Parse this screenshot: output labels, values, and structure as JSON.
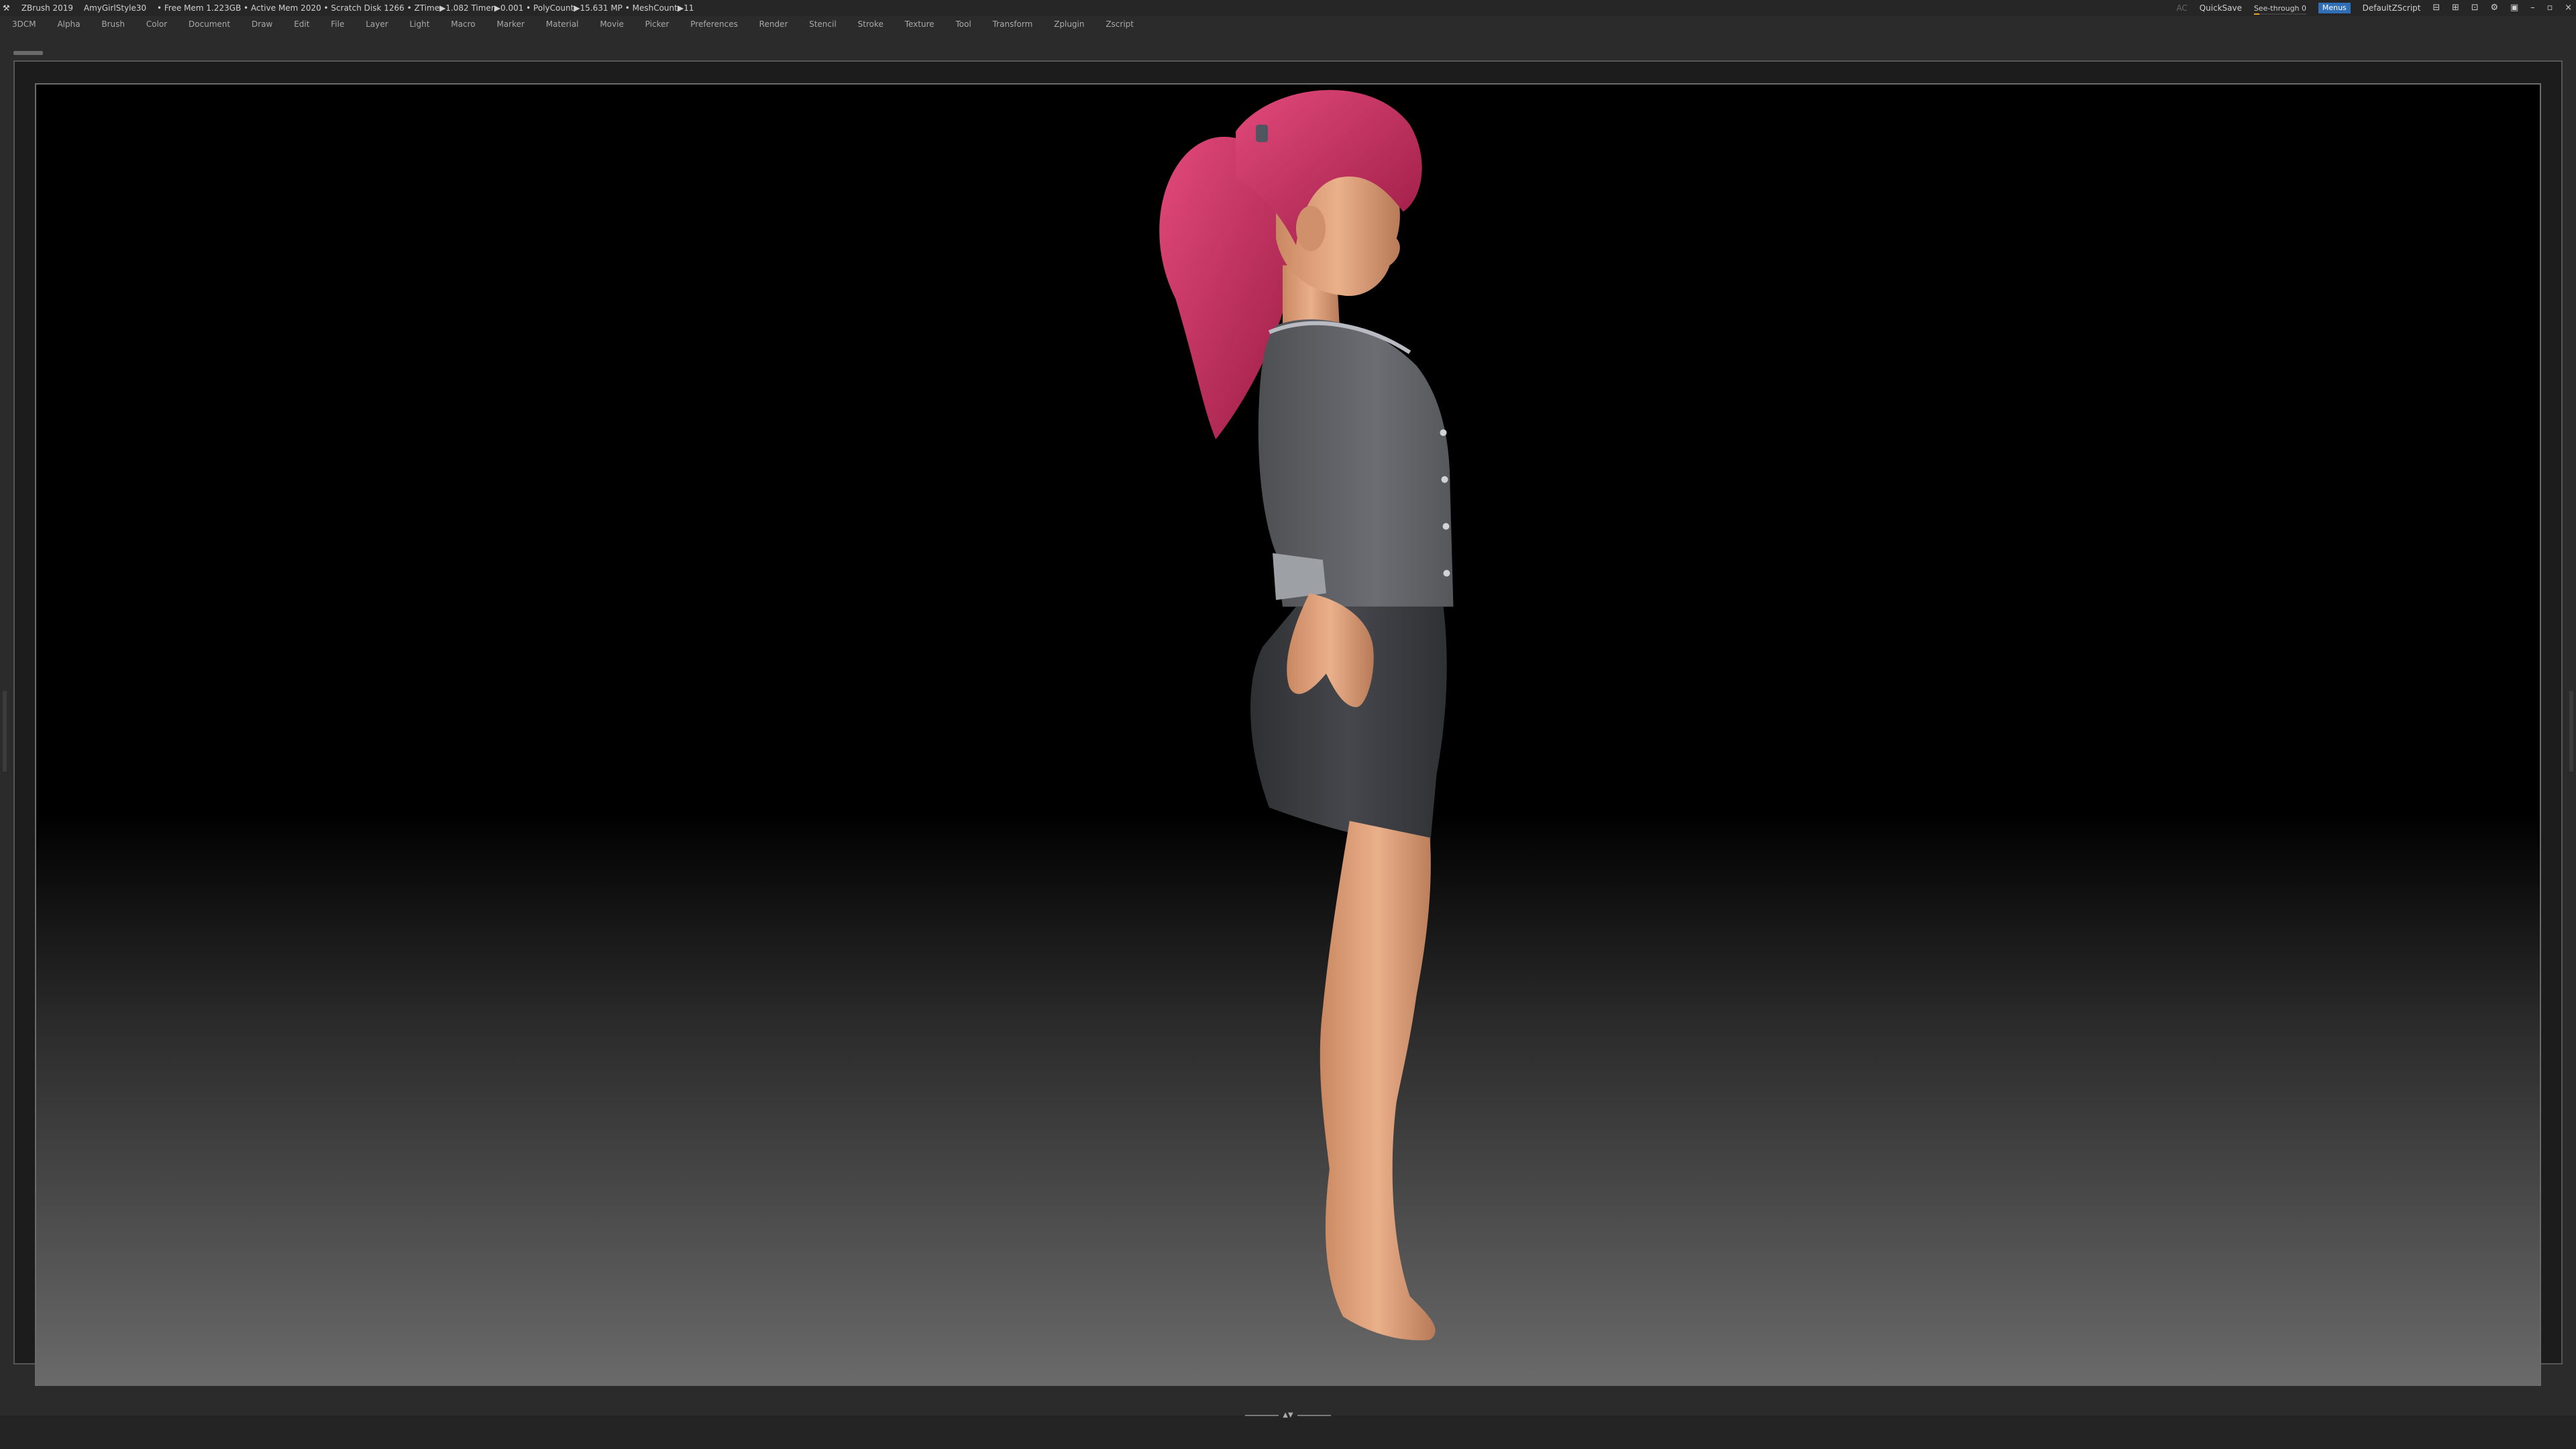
{
  "app": {
    "name": "ZBrush 2019",
    "document": "AmyGirlStyle30",
    "status": "• Free Mem 1.223GB • Active Mem 2020 • Scratch Disk 1266 • ZTime▶1.082 Timer▶0.001 • PolyCount▶15.631 MP • MeshCount▶11"
  },
  "titlebar": {
    "ac": "AC",
    "quicksave": "QuickSave",
    "see_through": "See-through 0",
    "see_through_level": 0,
    "menus": "Menus",
    "zscript": "DefaultZScript",
    "icons": [
      "layout-icon",
      "layout-icon",
      "palette-icon",
      "gear-icon",
      "lock-icon"
    ],
    "window_buttons": [
      "–",
      "▫",
      "×"
    ]
  },
  "menu": {
    "items": [
      "3DCM",
      "Alpha",
      "Brush",
      "Color",
      "Document",
      "Draw",
      "Edit",
      "File",
      "Layer",
      "Light",
      "Macro",
      "Marker",
      "Material",
      "Movie",
      "Picker",
      "Preferences",
      "Render",
      "Stencil",
      "Stroke",
      "Texture",
      "Tool",
      "Transform",
      "Zplugin",
      "Zscript"
    ]
  },
  "colors": {
    "accent": "#2f6fb5",
    "slider": "#e8a41a",
    "hair": "#c2255a",
    "jacket": "#5a5c60",
    "skirt": "#3a3c41",
    "skin": "#e4a27a"
  },
  "bottom_handle_glyph": "▲▼"
}
